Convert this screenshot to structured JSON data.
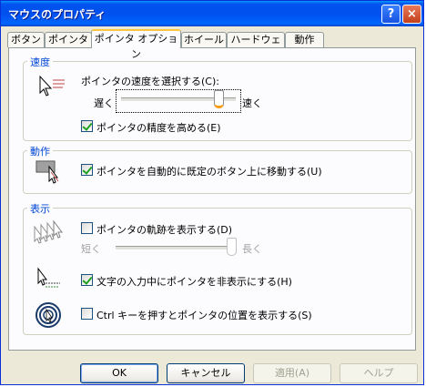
{
  "window": {
    "title": "マウスのプロパティ",
    "help_button": "?",
    "close_button": "×"
  },
  "tabs": [
    {
      "label": "ボタン"
    },
    {
      "label": "ポインタ"
    },
    {
      "label": "ポインタ オプション",
      "active": true
    },
    {
      "label": "ホイール"
    },
    {
      "label": "ハードウェア"
    },
    {
      "label": "動作"
    }
  ],
  "speed": {
    "group_label": "速度",
    "prompt": "ポインタの速度を選択する(C):",
    "slow_label": "遅く",
    "fast_label": "速く",
    "slider_value_fraction": 0.85,
    "enhance_precision": {
      "label": "ポインタの精度を高める(E)",
      "checked": true
    }
  },
  "snap": {
    "group_label": "動作",
    "snap_to_default": {
      "label": "ポインタを自動的に既定のボタン上に移動する(U)",
      "checked": true
    }
  },
  "visibility": {
    "group_label": "表示",
    "trails": {
      "label": "ポインタの軌跡を表示する(D)",
      "checked": false
    },
    "short_label": "短く",
    "long_label": "長く",
    "trail_slider_fraction": 1.0,
    "hide_while_typing": {
      "label": "文字の入力中にポインタを非表示にする(H)",
      "checked": true
    },
    "show_location_ctrl": {
      "label": "Ctrl キーを押すとポインタの位置を表示する(S)",
      "checked": false
    }
  },
  "buttons": {
    "ok": "OK",
    "cancel": "キャンセル",
    "apply": "適用(A)",
    "help": "ヘルプ"
  },
  "colors": {
    "titlebar": "#0053ee",
    "group_label": "#0046d5",
    "tab_highlight": "#ffc83c",
    "slider_accent": "#f89c10",
    "check_mark": "#21a121"
  }
}
